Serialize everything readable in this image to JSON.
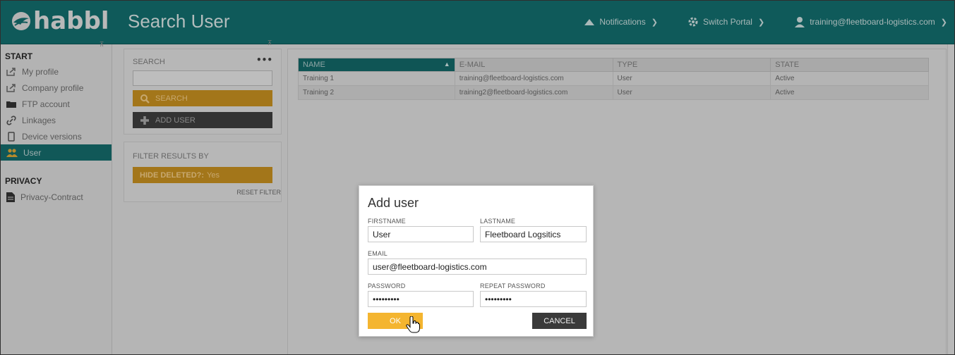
{
  "app": {
    "logo_text": "habbl",
    "page_title": "Search User"
  },
  "topnav": {
    "notifications": "Notifications",
    "switch_portal": "Switch Portal",
    "user_email": "training@fleetboard-logistics.com"
  },
  "sidebar": {
    "start_heading": "START",
    "start_items": [
      {
        "label": "My profile",
        "icon": "external-link-icon"
      },
      {
        "label": "Company profile",
        "icon": "external-link-icon"
      },
      {
        "label": "FTP account",
        "icon": "folder-icon"
      },
      {
        "label": "Linkages",
        "icon": "link-icon"
      },
      {
        "label": "Device versions",
        "icon": "mobile-icon"
      },
      {
        "label": "User",
        "icon": "users-icon",
        "active": true
      }
    ],
    "privacy_heading": "PRIVACY",
    "privacy_items": [
      {
        "label": "Privacy-Contract",
        "icon": "document-icon"
      }
    ]
  },
  "search_panel": {
    "label": "SEARCH",
    "more": "•••",
    "search_input_value": "",
    "search_button": "SEARCH",
    "add_user_button": "ADD USER"
  },
  "filter_panel": {
    "label": "FILTER RESULTS BY",
    "hide_deleted_label": "HIDE DELETED?:",
    "hide_deleted_value": "Yes",
    "reset_filter": "RESET FILTER"
  },
  "table": {
    "columns": [
      "NAME",
      "E-MAIL",
      "TYPE",
      "STATE"
    ],
    "sort_indicator": "▲",
    "rows": [
      {
        "name": "Training 1",
        "email": "training@fleetboard-logistics.com",
        "type": "User",
        "state": "Active"
      },
      {
        "name": "Training 2",
        "email": "training2@fleetboard-logistics.com",
        "type": "User",
        "state": "Active"
      }
    ]
  },
  "modal": {
    "title": "Add user",
    "firstname_label": "FIRSTNAME",
    "firstname_value": "User",
    "lastname_label": "LASTNAME",
    "lastname_value": "Fleetboard Logsitics",
    "email_label": "EMAIL",
    "email_value": "user@fleetboard-logistics.com",
    "password_label": "PASSWORD",
    "password_value": "123456789",
    "repeat_password_label": "REPEAT PASSWORD",
    "repeat_password_value": "123456789",
    "ok_button": "OK",
    "cancel_button": "CANCEL"
  },
  "colors": {
    "header_bg": "#0f5a5a",
    "active_item_bg": "#115858",
    "ok_button": "#f4b530",
    "cancel_button": "#3a3a3a",
    "overlay_orange": "#a3761a"
  }
}
